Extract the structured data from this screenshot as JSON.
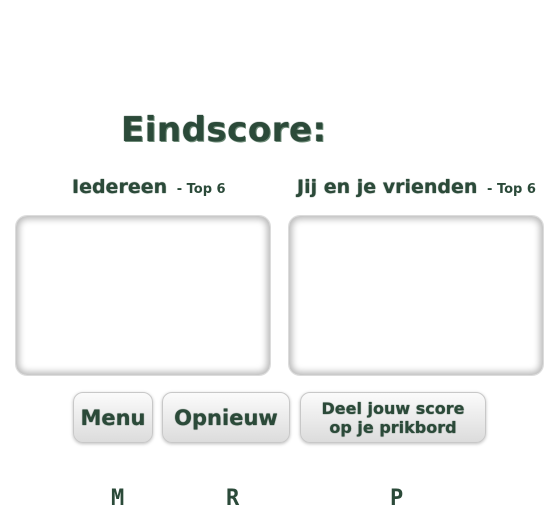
{
  "title": "Eindscore:",
  "leaderboards": {
    "all": {
      "label": "Iedereen",
      "suffix": "- Top 6"
    },
    "friends": {
      "label": "Jij en je vrienden",
      "suffix": "- Top 6"
    }
  },
  "buttons": {
    "menu": "Menu",
    "restart": "Opnieuw",
    "share": "Deel jouw score op je prikbord"
  },
  "hotkeys": {
    "menu": "M",
    "restart": "R",
    "share": "P"
  },
  "colors": {
    "text": "#2b4a39",
    "button_top": "#fbfbfb",
    "button_bottom": "#dcdcdc",
    "panel_shadow": "#b9b9b9"
  }
}
